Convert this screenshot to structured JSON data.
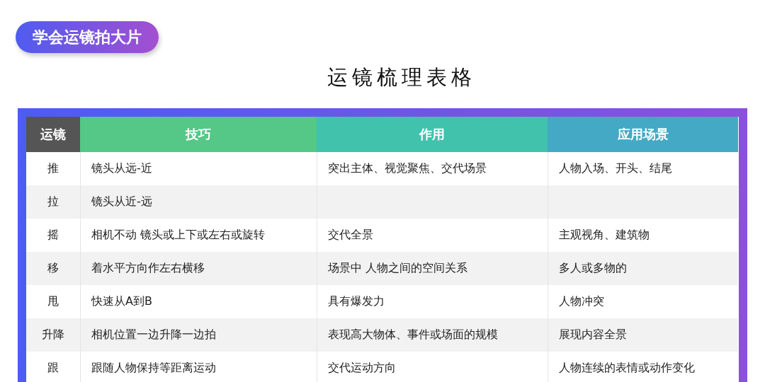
{
  "badge": "学会运镜拍大片",
  "title": "运镜梳理表格",
  "table": {
    "columns": [
      {
        "label": "运镜",
        "color": "#555555"
      },
      {
        "label": "技巧",
        "color": "#55c787"
      },
      {
        "label": "作用",
        "color": "#40c2ad"
      },
      {
        "label": "应用场景",
        "color": "#44a9c4"
      }
    ],
    "rows": [
      {
        "move": "推",
        "technique": "镜头从远-近",
        "effect": "突出主体、视觉聚焦、交代场景",
        "scene": "人物入场、开头、结尾"
      },
      {
        "move": "拉",
        "technique": "镜头从近-远"
      },
      {
        "move": "摇",
        "technique": "相机不动 镜头或上下或左右或旋转",
        "effect": "交代全景",
        "scene": "主观视角、建筑物"
      },
      {
        "move": "移",
        "technique": "着水平方向作左右横移",
        "effect": "场景中 人物之间的空间关系",
        "scene": "多人或多物的"
      },
      {
        "move": "甩",
        "technique": "快速从A到B",
        "effect": "具有爆发力",
        "scene": "人物冲突"
      },
      {
        "move": "升降",
        "technique": "相机位置一边升降一边拍",
        "effect": "表现高大物体、事件或场面的规模",
        "scene": "展现内容全景"
      },
      {
        "move": "跟",
        "technique": "跟随人物保持等距离运动",
        "effect": "交代运动方向",
        "scene": "人物连续的表情或动作变化"
      }
    ]
  }
}
